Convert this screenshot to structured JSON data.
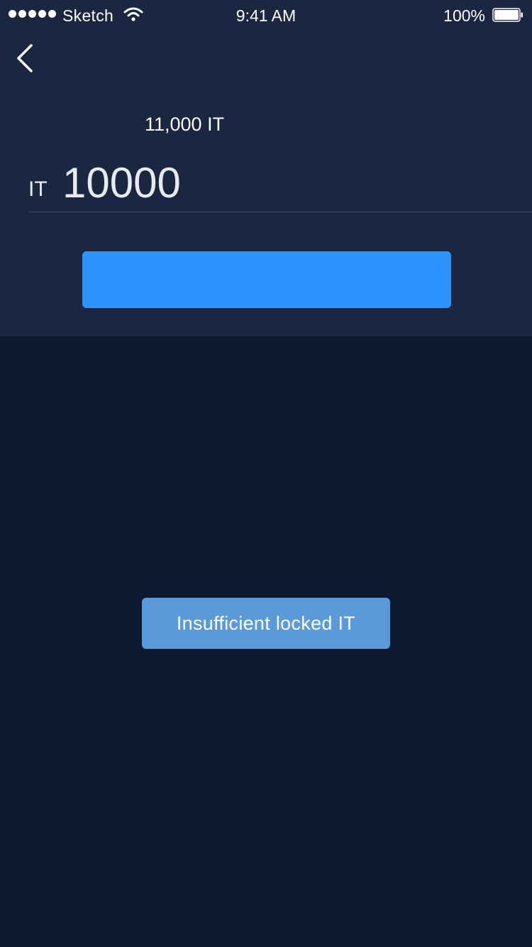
{
  "status_bar": {
    "carrier": "Sketch",
    "time": "9:41 AM",
    "battery_percent": "100%",
    "signal_icon": "signal-dots-icon",
    "wifi_icon": "wifi-icon",
    "battery_icon": "battery-full-icon"
  },
  "nav": {
    "back_icon": "chevron-left-icon"
  },
  "form": {
    "balance": "11,000 IT",
    "unit": "IT",
    "amount_value": "10000",
    "confirm_label": ""
  },
  "toast": {
    "message": "Insufficient locked IT"
  },
  "colors": {
    "top_panel_bg": "#1b2740",
    "page_bg": "#0b1a30",
    "primary_button": "#2e94fd",
    "toast_bg": "#5b9ad9"
  }
}
